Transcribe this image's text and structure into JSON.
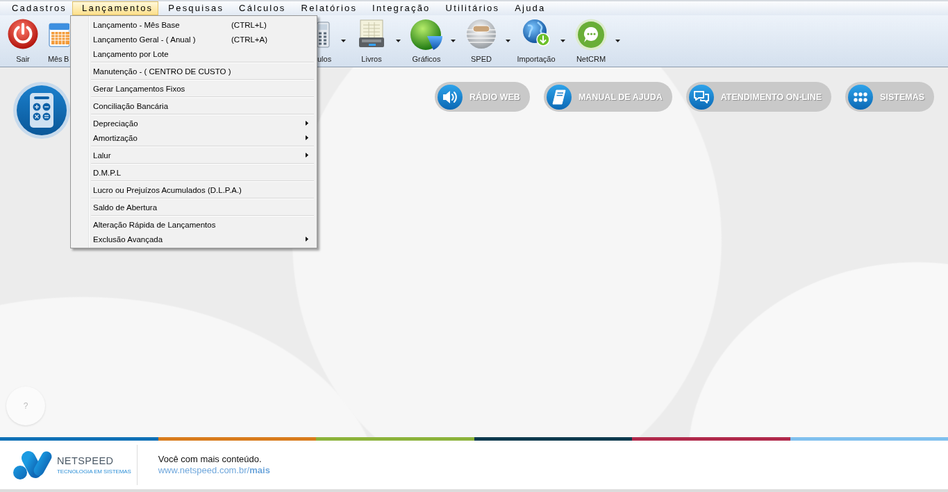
{
  "menu_bar": [
    {
      "label": "Cadastros",
      "selected": false
    },
    {
      "label": "Lançamentos",
      "selected": true
    },
    {
      "label": "Pesquisas",
      "selected": false
    },
    {
      "label": "Cálculos",
      "selected": false
    },
    {
      "label": "Relatórios",
      "selected": false
    },
    {
      "label": "Integração",
      "selected": false
    },
    {
      "label": "Utilitários",
      "selected": false
    },
    {
      "label": "Ajuda",
      "selected": false
    }
  ],
  "toolbar": [
    {
      "label": "Sair",
      "dropdown": false
    },
    {
      "label": "Mês B",
      "dropdown": false
    },
    {
      "label": "ulos",
      "dropdown": true
    },
    {
      "label": "Livros",
      "dropdown": true
    },
    {
      "label": "Gráficos",
      "dropdown": true
    },
    {
      "label": "SPED",
      "dropdown": true
    },
    {
      "label": "Importação",
      "dropdown": true
    },
    {
      "label": "NetCRM",
      "dropdown": true
    }
  ],
  "dropdown_menu": {
    "sections": [
      {
        "items": [
          {
            "label": "Lançamento - Mês Base",
            "shortcut": "(CTRL+L)",
            "submenu": false
          },
          {
            "label": "Lançamento Geral - ( Anual )",
            "shortcut": "(CTRL+A)",
            "submenu": false
          },
          {
            "label": "Lançamento por Lote",
            "submenu": false
          }
        ]
      },
      {
        "items": [
          {
            "label": "Manutenção - ( CENTRO DE CUSTO )",
            "submenu": false
          }
        ]
      },
      {
        "items": [
          {
            "label": "Gerar Lançamentos Fixos",
            "submenu": false
          }
        ]
      },
      {
        "items": [
          {
            "label": "Conciliação Bancária",
            "submenu": false
          }
        ]
      },
      {
        "items": [
          {
            "label": "Depreciação",
            "submenu": true
          },
          {
            "label": "Amortização",
            "submenu": true
          }
        ]
      },
      {
        "items": [
          {
            "label": "Lalur",
            "submenu": true
          }
        ]
      },
      {
        "items": [
          {
            "label": "D.M.P.L",
            "submenu": false
          }
        ]
      },
      {
        "items": [
          {
            "label": "Lucro ou Prejuízos Acumulados (D.L.P.A.)",
            "submenu": false
          }
        ]
      },
      {
        "items": [
          {
            "label": "Saldo de Abertura",
            "submenu": false
          }
        ]
      },
      {
        "items": [
          {
            "label": "Alteração Rápida de Lançamentos",
            "submenu": false
          },
          {
            "label": "Exclusão Avançada",
            "submenu": true
          }
        ]
      }
    ]
  },
  "quick_links": [
    {
      "label": "RÁDIO WEB"
    },
    {
      "label": "MANUAL DE AJUDA"
    },
    {
      "label": "ATENDIMENTO ON-LINE"
    },
    {
      "label": "SISTEMAS"
    }
  ],
  "help_button": {
    "label": "?"
  },
  "footer": {
    "brand": "NETSPEED",
    "tagline": "TECNOLOGIA EM SISTEMAS",
    "message": "Você com mais conteúdo.",
    "link": "www.netspeed.com.br/**mais**"
  }
}
